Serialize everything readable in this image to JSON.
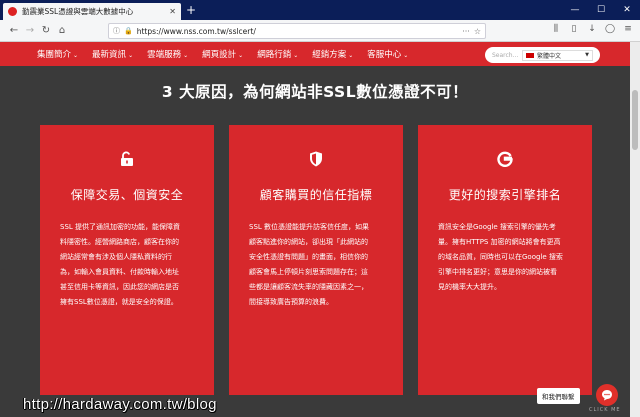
{
  "browser": {
    "tab_title": "勤震業SSL憑證與雲端大數據中心",
    "url": "https://www.nss.com.tw/sslcert/"
  },
  "site_nav": {
    "items": [
      {
        "label": "集團簡介"
      },
      {
        "label": "最新資訊"
      },
      {
        "label": "雲端服務"
      },
      {
        "label": "網頁設計"
      },
      {
        "label": "網路行銷"
      },
      {
        "label": "經銷方案"
      },
      {
        "label": "客服中心"
      }
    ],
    "search_placeholder": "Search...",
    "language": "繁體中文"
  },
  "main": {
    "heading": "3 大原因，為何網站非SSL數位憑證不可！",
    "cards": [
      {
        "icon": "unlock-icon",
        "title": "保障交易、個資安全",
        "lines": [
          "SSL 提供了通訊加密的功能，能保障資",
          "料隱密性。經營網路商店，顧客在你的",
          "網站經常會有涉及個人隱私資料的行",
          "為，如輸入會員資料、付款時輸入地址",
          "甚至信用卡等資訊，因此您的網店是否",
          "擁有SSL數位憑證，就是安全的保證。"
        ]
      },
      {
        "icon": "shield-icon",
        "title": "顧客購買的信任指標",
        "lines": [
          "SSL 數位憑證能提升訪客信任度，如果",
          "顧客點進你的網站，卻出現「此網站的",
          "安全性憑證有問題」的畫面，相信你的",
          "顧客會馬上停頓片刻思索問題存在；這",
          "些都是讓顧客流失率的隱藏因素之一，",
          "間接導致廣告預算的浪費。"
        ]
      },
      {
        "icon": "google-g-icon",
        "title": "更好的搜索引擎排名",
        "lines": [
          "資訊安全是Google 搜索引擎的優先考",
          "量。擁有HTTPS 加密的網站將會有更高",
          "的域名品質，同時也可以在Google 搜索",
          "引擎中排名更好；意思是你的網站被看",
          "見的機率大大提升。"
        ]
      }
    ]
  },
  "chat": {
    "label": "和我們聯繫",
    "hint": "CLICK ME"
  },
  "watermark": "http://hardaway.com.tw/blog",
  "colors": {
    "brand_red": "#d7282c",
    "background": "#3a3a3a",
    "tabbar": "#0b1e58"
  }
}
